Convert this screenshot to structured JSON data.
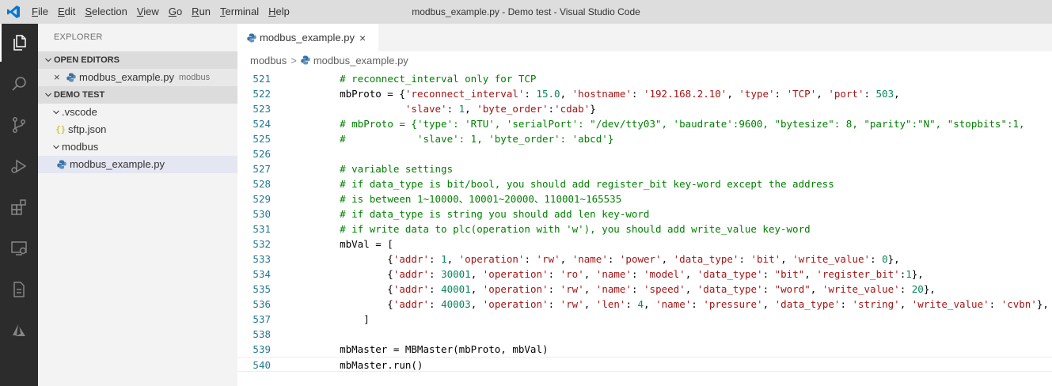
{
  "window": {
    "title": "modbus_example.py - Demo test - Visual Studio Code"
  },
  "menu": [
    {
      "mnemonic": "F",
      "rest": "ile"
    },
    {
      "mnemonic": "E",
      "rest": "dit"
    },
    {
      "mnemonic": "S",
      "rest": "election"
    },
    {
      "mnemonic": "V",
      "rest": "iew"
    },
    {
      "mnemonic": "G",
      "rest": "o"
    },
    {
      "mnemonic": "R",
      "rest": "un"
    },
    {
      "mnemonic": "T",
      "rest": "erminal"
    },
    {
      "mnemonic": "H",
      "rest": "elp"
    }
  ],
  "activity_bar": [
    "explorer-icon",
    "search-icon",
    "source-control-icon",
    "run-debug-icon",
    "extensions-icon",
    "remote-explorer-icon",
    "notebook-icon",
    "azure-icon"
  ],
  "sidebar": {
    "title": "EXPLORER",
    "open_editors": {
      "label": "OPEN EDITORS",
      "items": [
        {
          "name": "modbus_example.py",
          "description": "modbus"
        }
      ]
    },
    "workspace": {
      "label": "DEMO TEST",
      "tree": [
        {
          "name": ".vscode",
          "type": "folder"
        },
        {
          "name": "sftp.json",
          "type": "json"
        },
        {
          "name": "modbus",
          "type": "folder"
        },
        {
          "name": "modbus_example.py",
          "type": "python"
        }
      ]
    },
    "json_glyph": "{}"
  },
  "tab": {
    "label": "modbus_example.py",
    "close": "×"
  },
  "breadcrumb": {
    "folder": "modbus",
    "separator": ">",
    "file": "modbus_example.py"
  },
  "colors": {
    "comment": "#008000",
    "string": "#a31515",
    "number": "#098658",
    "line_number": "#237893",
    "activity_bar": "#2c2c2c",
    "accent": "#0078d4"
  },
  "editor": {
    "lines": [
      {
        "n": "521",
        "text": "    # reconnect_interval only for TCP"
      },
      {
        "n": "522",
        "text": "    mbProto = {'reconnect_interval': 15.0, 'hostname': '192.168.2.10', 'type': 'TCP', 'port': 503,"
      },
      {
        "n": "523",
        "text": "               'slave': 1, 'byte_order':'cdab'}"
      },
      {
        "n": "524",
        "text": "    # mbProto = {'type': 'RTU', 'serialPort': \"/dev/tty03\", 'baudrate':9600, \"bytesize\": 8, \"parity\":\"N\", \"stopbits\":1,"
      },
      {
        "n": "525",
        "text": "    #            'slave': 1, 'byte_order': 'abcd'}"
      },
      {
        "n": "526",
        "text": ""
      },
      {
        "n": "527",
        "text": "    # variable settings"
      },
      {
        "n": "528",
        "text": "    # if data_type is bit/bool, you should add register_bit key-word except the address"
      },
      {
        "n": "529",
        "text": "    # is between 1~10000、10001~20000、110001~165535"
      },
      {
        "n": "530",
        "text": "    # if data_type is string you should add len key-word"
      },
      {
        "n": "531",
        "text": "    # if write data to plc(operation with 'w'), you should add write_value key-word"
      },
      {
        "n": "532",
        "text": "    mbVal = ["
      },
      {
        "n": "533",
        "text": "            {'addr': 1, 'operation': 'rw', 'name': 'power', 'data_type': 'bit', 'write_value': 0},"
      },
      {
        "n": "534",
        "text": "            {'addr': 30001, 'operation': 'ro', 'name': 'model', 'data_type': \"bit\", 'register_bit':1},"
      },
      {
        "n": "535",
        "text": "            {'addr': 40001, 'operation': 'rw', 'name': 'speed', 'data_type': \"word\", 'write_value': 20},"
      },
      {
        "n": "536",
        "text": "            {'addr': 40003, 'operation': 'rw', 'len': 4, 'name': 'pressure', 'data_type': 'string', 'write_value': 'cvbn'},"
      },
      {
        "n": "537",
        "text": "        ]"
      },
      {
        "n": "538",
        "text": ""
      },
      {
        "n": "539",
        "text": "    mbMaster = MBMaster(mbProto, mbVal)"
      },
      {
        "n": "540",
        "text": "    mbMaster.run()"
      }
    ]
  }
}
